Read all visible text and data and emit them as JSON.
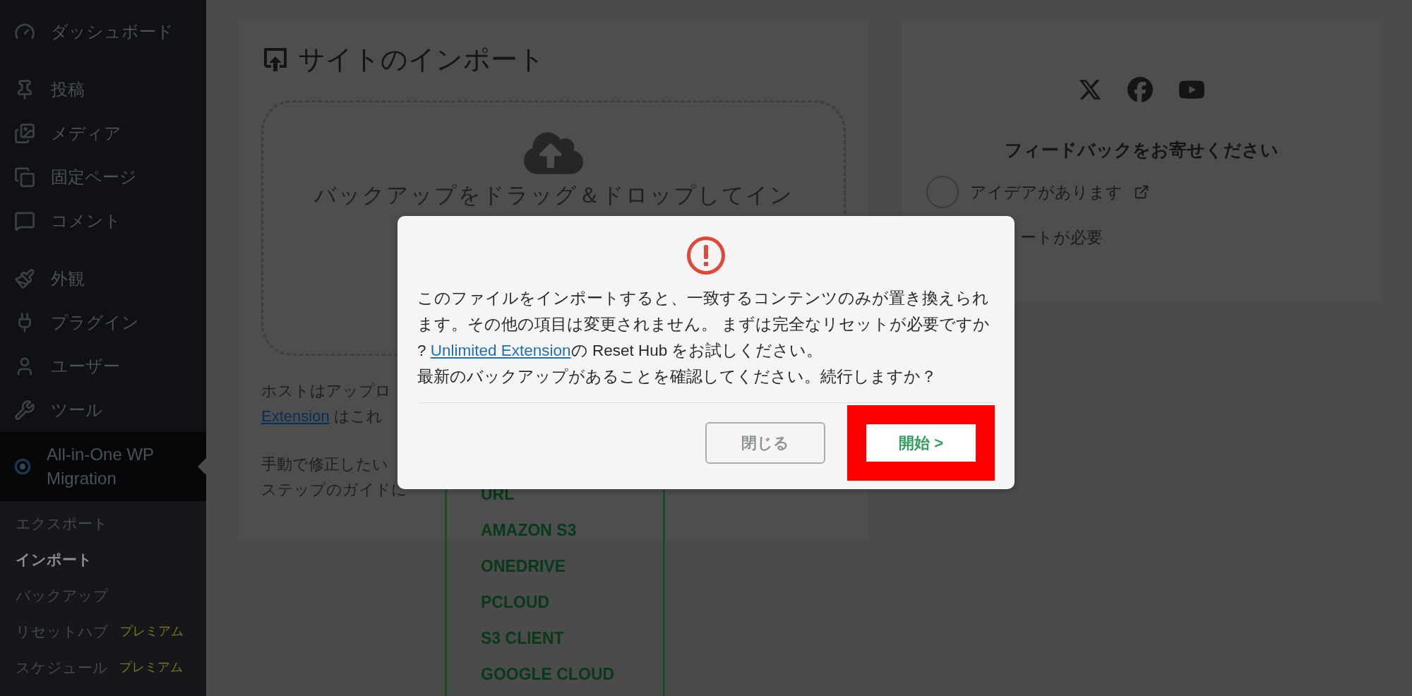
{
  "sidebar": {
    "groups": [
      [
        {
          "label": "ダッシュボード",
          "selected": false
        }
      ],
      [
        {
          "label": "投稿",
          "selected": false
        },
        {
          "label": "メディア",
          "selected": false
        },
        {
          "label": "固定ページ",
          "selected": false
        },
        {
          "label": "コメント",
          "selected": false
        }
      ],
      [
        {
          "label": "外観",
          "selected": false
        },
        {
          "label": "プラグイン",
          "selected": false
        },
        {
          "label": "ユーザー",
          "selected": false
        },
        {
          "label": "ツール",
          "selected": false
        },
        {
          "label": "All-in-One WP Migration",
          "selected": true
        }
      ]
    ],
    "submenu": [
      {
        "label": "エクスポート",
        "selected": false
      },
      {
        "label": "インポート",
        "selected": true
      },
      {
        "label": "バックアップ",
        "selected": false
      },
      {
        "label": "リセットハブ",
        "selected": false,
        "badge": "プレミアム"
      },
      {
        "label": "スケジュール",
        "selected": false,
        "badge": "プレミアム"
      }
    ]
  },
  "import_card": {
    "title": "サイトのインポート",
    "dropzone_text": "バックアップをドラッグ＆ドロップしてイン",
    "notes": [
      {
        "lines": [
          {
            "text": "ホストはアップロ"
          },
          {
            "link": "Extension",
            "text": " はこれ"
          }
        ]
      },
      {
        "lines": [
          {
            "text": "手動で修正したい"
          },
          {
            "text": "ステップのガイドに"
          }
        ]
      }
    ],
    "import_menu": [
      "URL",
      "AMAZON S3",
      "ONEDRIVE",
      "PCLOUD",
      "S3 CLIENT",
      "GOOGLE CLOUD"
    ]
  },
  "feedback_card": {
    "title": "フィードバックをお寄せください",
    "options": [
      {
        "label": "アイデアがあります",
        "selected": false,
        "external": true
      },
      {
        "label": "ートが必要",
        "external": false
      }
    ]
  },
  "dialog": {
    "message_before": "このファイルをインポートすると、一致するコンテンツのみが置き換えられます。その他の項目は変更されません。 まずは完全なリセットが必要ですか?",
    "link": "Unlimited Extension",
    "message_after": "の Reset Hub をお試しください。",
    "confirm": "最新のバックアップがあることを確認してください。続行しますか？",
    "buttons": [
      {
        "label": "閉じる",
        "kind": "secondary",
        "highlighted": false
      },
      {
        "label": "開始 >",
        "kind": "primary",
        "highlighted": true
      }
    ]
  }
}
